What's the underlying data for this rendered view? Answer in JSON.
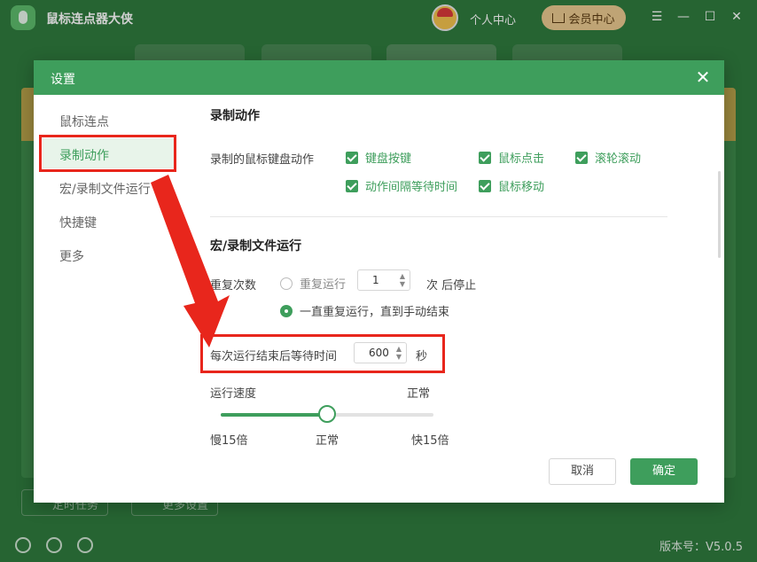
{
  "app": {
    "title": "鼠标连点器大侠",
    "user_center": "个人中心",
    "vip_center": "会员中心",
    "version": "版本号：V5.0.5"
  },
  "dialog": {
    "title": "设置",
    "nav": [
      "鼠标连点",
      "录制动作",
      "宏/录制文件运行",
      "快捷键",
      "更多"
    ],
    "active_nav": "录制动作",
    "record_section": {
      "title": "录制动作",
      "label": "录制的鼠标键盘动作",
      "checkboxes": [
        {
          "label": "键盘按键",
          "checked": true
        },
        {
          "label": "鼠标点击",
          "checked": true
        },
        {
          "label": "滚轮滚动",
          "checked": true
        },
        {
          "label": "动作间隔等待时间",
          "checked": true
        },
        {
          "label": "鼠标移动",
          "checked": true
        }
      ]
    },
    "macro_section": {
      "title": "宏/录制文件运行",
      "repeat_label": "重复次数",
      "radio_repeat": "重复运行",
      "repeat_value": "1",
      "repeat_suffix": "次 后停止",
      "radio_forever": "一直重复运行，直到手动结束",
      "wait_label": "每次运行结束后等待时间",
      "wait_value": "600",
      "wait_unit": "秒",
      "speed_label": "运行速度",
      "speed_current": "正常",
      "speed_min": "慢15倍",
      "speed_mid": "正常",
      "speed_max": "快15倍",
      "speed_fraction": 0.5
    },
    "cancel": "取消",
    "confirm": "确定"
  },
  "background": {
    "timer_task": "定时任务",
    "more_settings": "更多设置"
  },
  "colors": {
    "accent": "#3e9e5c",
    "annotation": "#e8261c"
  }
}
